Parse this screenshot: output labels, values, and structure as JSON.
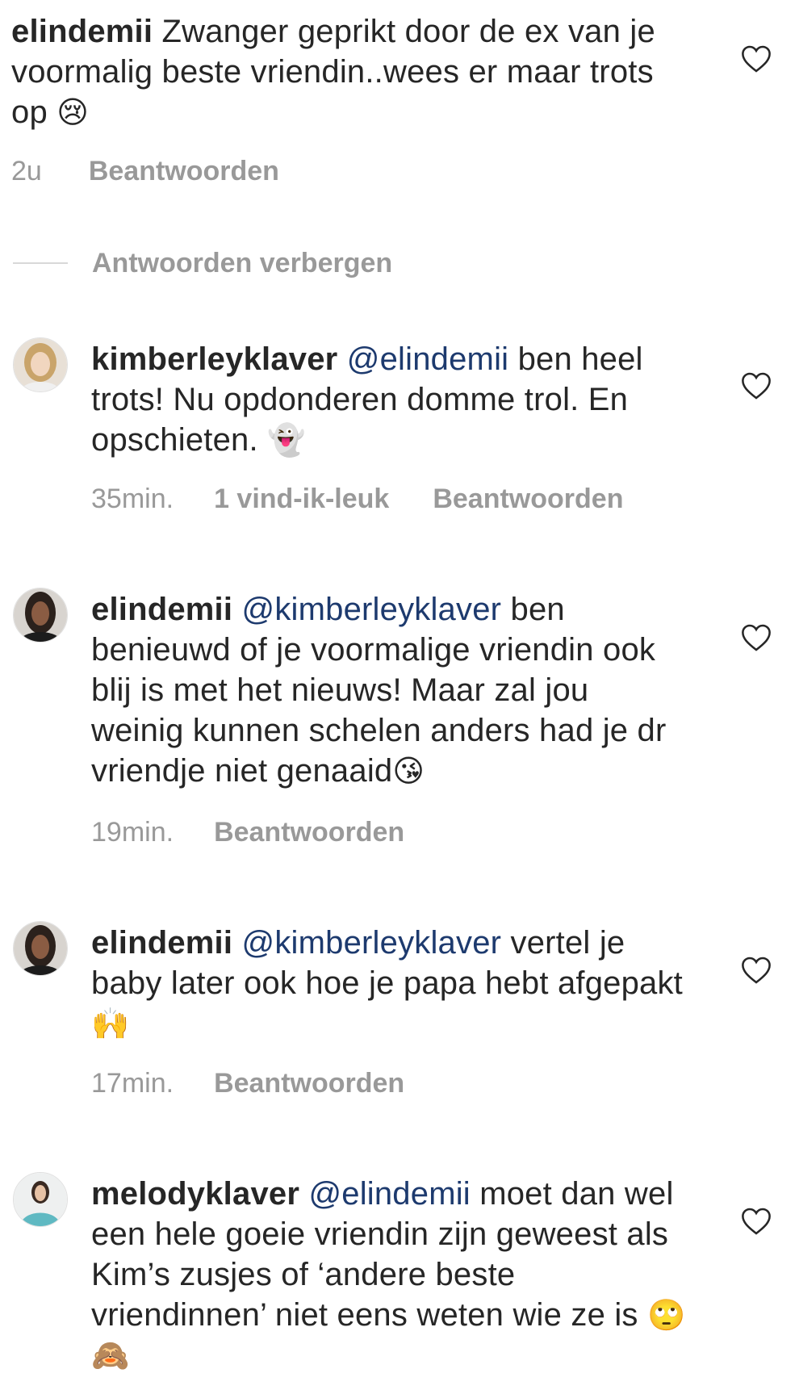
{
  "comments": [
    {
      "username": "elindemii",
      "mention": "",
      "text_before": " Zwanger geprikt door de ex van je voormalig beste vriendin..wees er maar trots op ",
      "emoji": "😢",
      "time": "2u",
      "likes": "",
      "reply_label": "Beantwoorden",
      "avatar_icon": "none"
    },
    {
      "username": "kimberleyklaver",
      "mention": "@elindemii",
      "text_before": " ben heel trots! Nu opdonderen domme trol. En opschieten. ",
      "emoji": "👻",
      "time": "35min.",
      "likes": "1 vind-ik-leuk",
      "reply_label": "Beantwoorden",
      "avatar_icon": "user-avatar"
    },
    {
      "username": "elindemii",
      "mention": "@kimberleyklaver",
      "text_before": " ben benieuwd of je voormalige vriendin ook blij is met het nieuws! Maar zal jou weinig kunnen schelen anders had je dr vriendje niet genaaid",
      "emoji": "😘",
      "time": "19min.",
      "likes": "",
      "reply_label": "Beantwoorden",
      "avatar_icon": "user-avatar"
    },
    {
      "username": "elindemii",
      "mention": "@kimberleyklaver",
      "text_before": " vertel je baby later ook hoe je papa hebt afgepakt ",
      "emoji": "🙌",
      "time": "17min.",
      "likes": "",
      "reply_label": "Beantwoorden",
      "avatar_icon": "user-avatar"
    },
    {
      "username": "melodyklaver",
      "mention": "@elindemii",
      "text_before": " moet dan wel een hele goeie vriendin zijn geweest als Kim’s zusjes of ‘andere beste vriendinnen’ niet eens weten wie ze is ",
      "emoji": "🙄 🙈",
      "time": "",
      "likes": "",
      "reply_label": "",
      "avatar_icon": "user-avatar"
    }
  ],
  "hide_replies_label": "Antwoorden verbergen",
  "icons": {
    "like": "heart-outline-icon"
  },
  "colors": {
    "text": "#262626",
    "muted": "#999999",
    "mention": "#1d3a6e"
  }
}
